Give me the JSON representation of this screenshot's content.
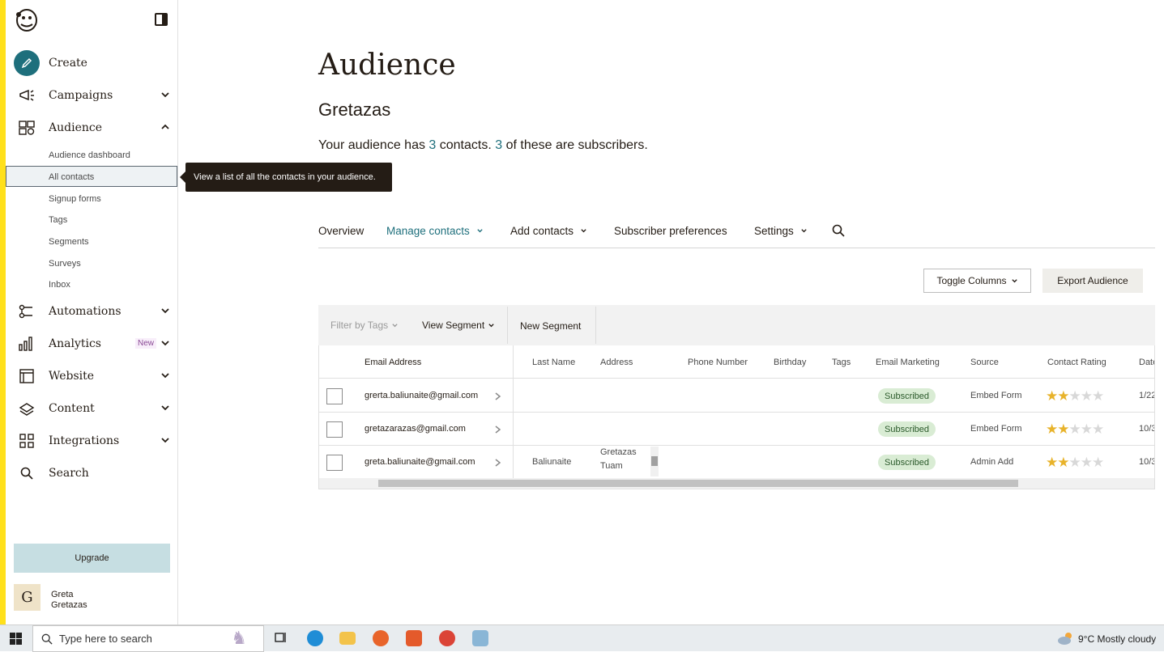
{
  "sidebar": {
    "nav": [
      {
        "label": "Create"
      },
      {
        "label": "Campaigns"
      },
      {
        "label": "Audience"
      },
      {
        "label": "Automations"
      },
      {
        "label": "Analytics",
        "badge": "New"
      },
      {
        "label": "Website"
      },
      {
        "label": "Content"
      },
      {
        "label": "Integrations"
      },
      {
        "label": "Search"
      }
    ],
    "audience_sub": [
      "Audience dashboard",
      "All contacts",
      "Signup forms",
      "Tags",
      "Segments",
      "Surveys",
      "Inbox"
    ],
    "upgrade_label": "Upgrade",
    "user": {
      "initial": "G",
      "name": "Greta",
      "org": "Gretazas"
    }
  },
  "tooltip": "View a list of all the contacts in your audience.",
  "main": {
    "title": "Audience",
    "audience_name": "Gretazas",
    "summary": {
      "pre": "Your audience has ",
      "contacts": "3",
      "mid": " contacts. ",
      "subscribers": "3",
      "post": " of these are subscribers."
    },
    "tabs": [
      {
        "label": "Overview"
      },
      {
        "label": "Manage contacts"
      },
      {
        "label": "Add contacts"
      },
      {
        "label": "Subscriber preferences"
      },
      {
        "label": "Settings"
      }
    ],
    "toggle_columns": "Toggle Columns",
    "export_audience": "Export Audience",
    "filters": {
      "filter_by_tags": "Filter by Tags",
      "view_segment": "View Segment",
      "new_segment": "New Segment"
    }
  },
  "table": {
    "columns": [
      "Email Address",
      "Last Name",
      "Address",
      "Phone Number",
      "Birthday",
      "Tags",
      "Email Marketing",
      "Source",
      "Contact Rating",
      "Date"
    ],
    "rows": [
      {
        "email": "grerta.baliunaite@gmail.com",
        "last_name": "",
        "address_1": "",
        "address_2": "",
        "marketing": "Subscribed",
        "source": "Embed Form",
        "rating": 2,
        "date": "1/22,"
      },
      {
        "email": "gretazarazas@gmail.com",
        "last_name": "",
        "address_1": "",
        "address_2": "",
        "marketing": "Subscribed",
        "source": "Embed Form",
        "rating": 2,
        "date": "10/3"
      },
      {
        "email": "greta.baliunaite@gmail.com",
        "last_name": "Baliunaite",
        "address_1": "Gretazas",
        "address_2": "Tuam",
        "marketing": "Subscribed",
        "source": "Admin Add",
        "rating": 2,
        "date": "10/3"
      }
    ]
  },
  "taskbar": {
    "search_placeholder": "Type here to search",
    "weather": "9°C  Mostly cloudy"
  },
  "colors": {
    "brand_yellow": "#ffe01b",
    "accent_teal": "#1e6f7c",
    "star": "#e8b32b"
  }
}
